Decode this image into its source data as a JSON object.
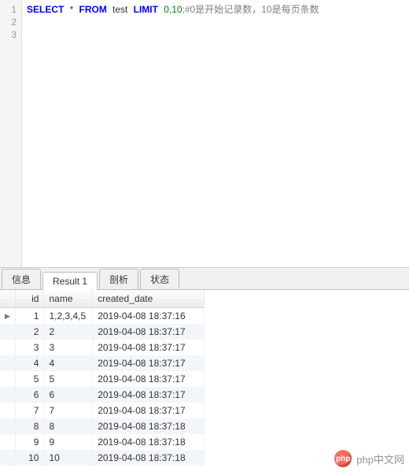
{
  "editor": {
    "lines": [
      "1",
      "2",
      "3"
    ],
    "tokens": {
      "kw_select": "SELECT",
      "star": "*",
      "kw_from": "FROM",
      "table": "test",
      "kw_limit": "LIMIT",
      "args": "0,10",
      "comment": ";#0是开始记录数，10是每页条数"
    }
  },
  "tabs": {
    "items": [
      {
        "label": "信息",
        "active": false
      },
      {
        "label": "Result 1",
        "active": true
      },
      {
        "label": "剖析",
        "active": false
      },
      {
        "label": "状态",
        "active": false
      }
    ]
  },
  "grid": {
    "row_marker": "▶",
    "columns": {
      "id": "id",
      "name": "name",
      "created_date": "created_date"
    },
    "rows": [
      {
        "id": "1",
        "name": "1,2,3,4,5",
        "created_date": "2019-04-08 18:37:16"
      },
      {
        "id": "2",
        "name": "2",
        "created_date": "2019-04-08 18:37:17"
      },
      {
        "id": "3",
        "name": "3",
        "created_date": "2019-04-08 18:37:17"
      },
      {
        "id": "4",
        "name": "4",
        "created_date": "2019-04-08 18:37:17"
      },
      {
        "id": "5",
        "name": "5",
        "created_date": "2019-04-08 18:37:17"
      },
      {
        "id": "6",
        "name": "6",
        "created_date": "2019-04-08 18:37:17"
      },
      {
        "id": "7",
        "name": "7",
        "created_date": "2019-04-08 18:37:17"
      },
      {
        "id": "8",
        "name": "8",
        "created_date": "2019-04-08 18:37:18"
      },
      {
        "id": "9",
        "name": "9",
        "created_date": "2019-04-08 18:37:18"
      },
      {
        "id": "10",
        "name": "10",
        "created_date": "2019-04-08 18:37:18"
      }
    ]
  },
  "watermark": {
    "logo_text": "php",
    "site": "php中文网"
  }
}
